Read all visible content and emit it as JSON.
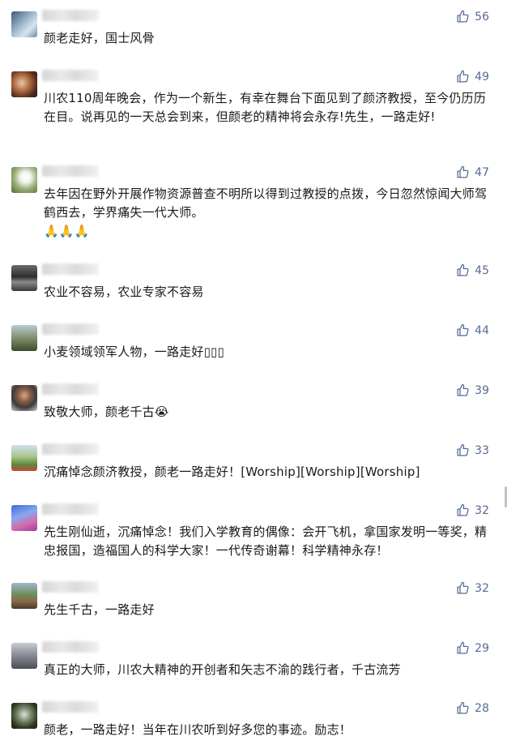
{
  "accent_color": "#576b95",
  "comments": [
    {
      "likes": "56",
      "text": "颜老走好，国士风骨"
    },
    {
      "likes": "49",
      "text": "川农110周年晚会，作为一个新生，有幸在舞台下面见到了颜济教授，至今仍历历在目。说再见的一天总会到来，但颜老的精神将会永存!先生，一路走好!"
    },
    {
      "likes": "47",
      "text": "去年因在野外开展作物资源普查不明所以得到过教授的点拨，今日忽然惊闻大师驾鹤西去，学界痛失一代大师。",
      "extra": "🙏🙏🙏"
    },
    {
      "likes": "45",
      "text": "农业不容易，农业专家不容易"
    },
    {
      "likes": "44",
      "text": "小麦领域领军人物，一路走好▯▯▯"
    },
    {
      "likes": "39",
      "text": "致敬大师，颜老千古😭"
    },
    {
      "likes": "33",
      "text": "沉痛悼念颜济教授，颜老一路走好！[Worship][Worship][Worship]"
    },
    {
      "likes": "32",
      "text": "先生刚仙逝，沉痛悼念！我们入学教育的偶像：会开飞机，拿国家发明一等奖，精忠报国，造福国人的科学大家！一代传奇谢幕！科学精神永存！"
    },
    {
      "likes": "32",
      "text": "先生千古，一路走好"
    },
    {
      "likes": "29",
      "text": "真正的大师，川农大精神的开创者和矢志不渝的践行者，千古流芳"
    },
    {
      "likes": "28",
      "text": "颜老，一路走好！当年在川农听到好多您的事迹。励志！"
    }
  ]
}
